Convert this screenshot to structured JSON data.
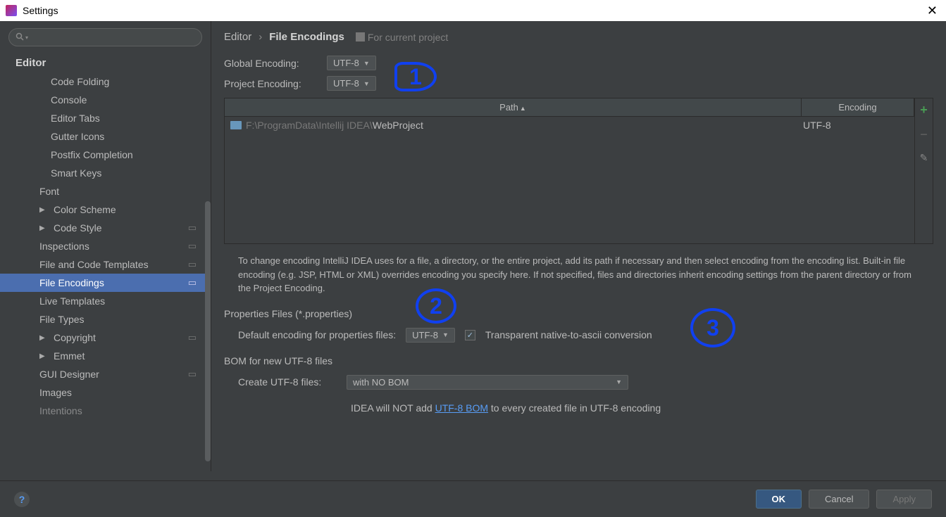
{
  "window": {
    "title": "Settings"
  },
  "sidebar": {
    "search_placeholder": "",
    "editor_label": "Editor",
    "items": {
      "code_folding": "Code Folding",
      "console": "Console",
      "editor_tabs": "Editor Tabs",
      "gutter_icons": "Gutter Icons",
      "postfix_completion": "Postfix Completion",
      "smart_keys": "Smart Keys",
      "font": "Font",
      "color_scheme": "Color Scheme",
      "code_style": "Code Style",
      "inspections": "Inspections",
      "file_code_templates": "File and Code Templates",
      "file_encodings": "File Encodings",
      "live_templates": "Live Templates",
      "file_types": "File Types",
      "copyright": "Copyright",
      "emmet": "Emmet",
      "gui_designer": "GUI Designer",
      "images": "Images",
      "intentions": "Intentions"
    }
  },
  "breadcrumb": {
    "root": "Editor",
    "current": "File Encodings",
    "badge": "For current project"
  },
  "form": {
    "global_label": "Global Encoding:",
    "global_value": "UTF-8",
    "project_label": "Project Encoding:",
    "project_value": "UTF-8"
  },
  "table": {
    "col_path": "Path",
    "col_encoding": "Encoding",
    "row_path_prefix": "F:\\ProgramData\\Intellij IDEA\\",
    "row_path_name": "WebProject",
    "row_encoding": "UTF-8"
  },
  "help_text": "To change encoding IntelliJ IDEA uses for a file, a directory, or the entire project, add its path if necessary and then select encoding from the encoding list. Built-in file encoding (e.g. JSP, HTML or XML) overrides encoding you specify here. If not specified, files and directories inherit encoding settings from the parent directory or from the Project Encoding.",
  "properties": {
    "section": "Properties Files (*.properties)",
    "default_label": "Default encoding for properties files:",
    "default_value": "UTF-8",
    "checkbox_label": "Transparent native-to-ascii conversion",
    "checkbox_checked": true
  },
  "bom": {
    "section": "BOM for new UTF-8 files",
    "create_label": "Create UTF-8 files:",
    "create_value": "with NO BOM",
    "note_prefix": "IDEA will NOT add ",
    "note_link": "UTF-8 BOM",
    "note_suffix": " to every created file in UTF-8 encoding"
  },
  "footer": {
    "ok": "OK",
    "cancel": "Cancel",
    "apply": "Apply"
  },
  "annotations": {
    "a1": "1",
    "a2": "2",
    "a3": "3"
  }
}
